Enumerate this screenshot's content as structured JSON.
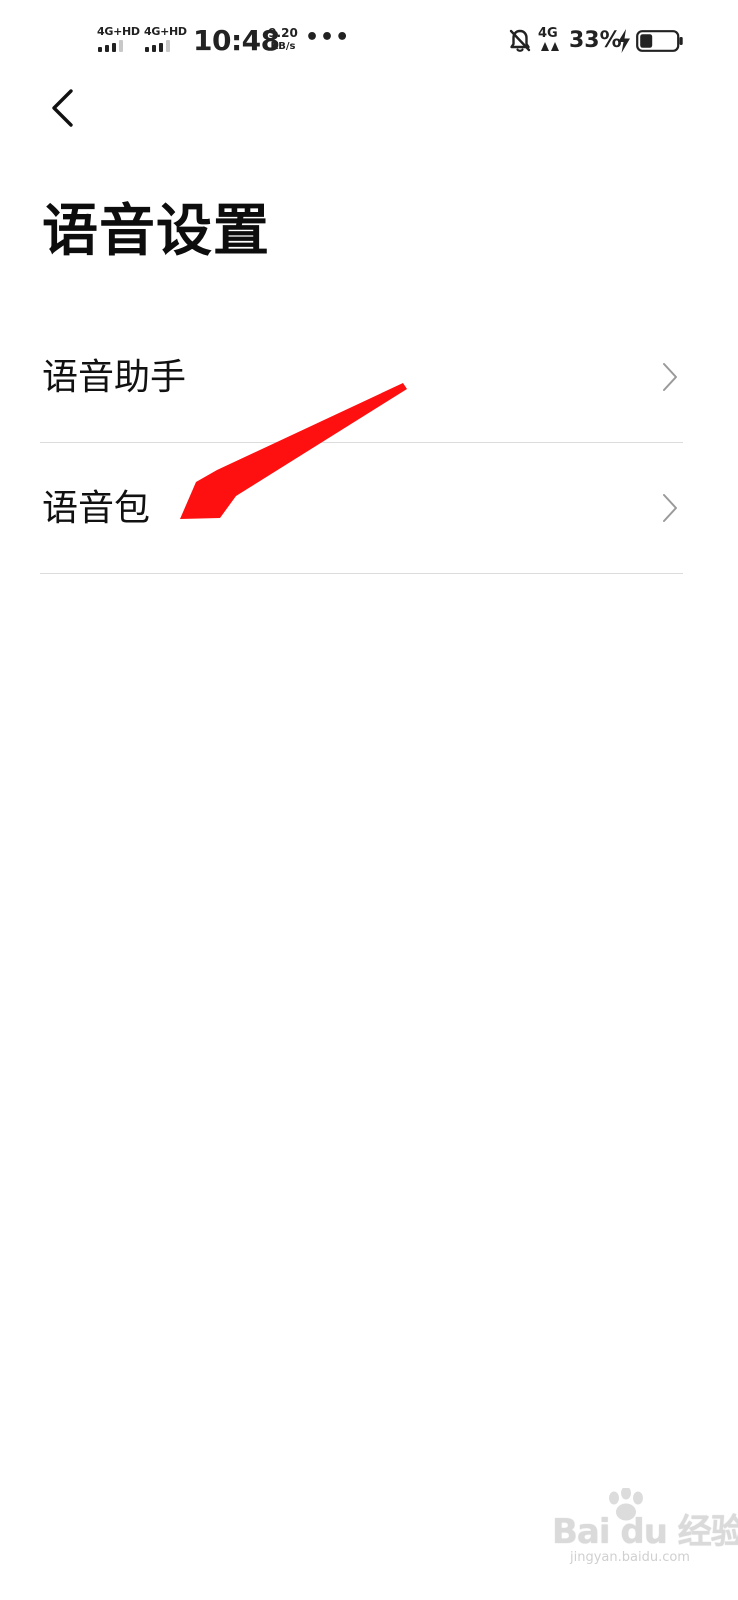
{
  "status_bar": {
    "network1_label": "4G+HD",
    "network2_label": "4G+HD",
    "time": "10:48",
    "speed_value": "9.20",
    "speed_unit": "KB/s",
    "more_indicator": "•••",
    "mobile_data_label": "4G",
    "battery_percent": "33%",
    "battery_level": 0.33,
    "icons": [
      "signal-icon",
      "signal-icon",
      "more-dots-icon",
      "bell-muted-icon",
      "mobile-data-icon",
      "charging-bolt-icon",
      "battery-icon"
    ]
  },
  "header": {
    "back_icon": "chevron-left-icon",
    "title": "语音设置"
  },
  "list": {
    "items": [
      {
        "label": "语音助手",
        "icon": "chevron-right-icon"
      },
      {
        "label": "语音包",
        "icon": "chevron-right-icon"
      }
    ]
  },
  "annotation": {
    "arrow_color": "#ff1010",
    "points_to": "语音包"
  },
  "watermark": {
    "brand": "Bai du 经验",
    "sub": "jingyan.baidu.com"
  }
}
